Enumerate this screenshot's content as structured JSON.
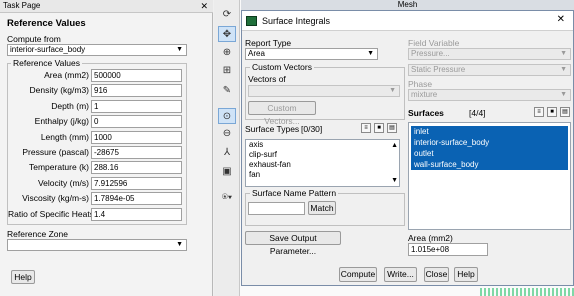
{
  "task_page": {
    "title": "Task Page",
    "close": "✕",
    "heading": "Reference Values",
    "compute_from_label": "Compute from",
    "compute_from_value": "interior-surface_body",
    "group_label": "Reference Values",
    "fields": [
      {
        "label": "Area (mm2)",
        "value": "500000"
      },
      {
        "label": "Density (kg/m3)",
        "value": "916"
      },
      {
        "label": "Depth (m)",
        "value": "1"
      },
      {
        "label": "Enthalpy (j/kg)",
        "value": "0"
      },
      {
        "label": "Length (mm)",
        "value": "1000"
      },
      {
        "label": "Pressure (pascal)",
        "value": "-28675"
      },
      {
        "label": "Temperature (k)",
        "value": "288.16"
      },
      {
        "label": "Velocity (m/s)",
        "value": "7.912596"
      },
      {
        "label": "Viscosity (kg/m-s)",
        "value": "1.7894e-05"
      },
      {
        "label": "Ratio of Specific Heats",
        "value": "1.4"
      }
    ],
    "reference_zone_label": "Reference Zone",
    "reference_zone_value": "",
    "help_label": "Help"
  },
  "toolbar": {
    "icons": [
      "rotate-icon",
      "pan-icon",
      "zoom-in-icon",
      "zoom-box-icon",
      "probe-icon",
      "zoom-fit-icon",
      "zoom-out-icon",
      "axes-icon",
      "camera-icon",
      "view-dropdown-icon"
    ]
  },
  "graphics": {
    "title": "Mesh"
  },
  "dialog": {
    "title": "Surface Integrals",
    "close": "✕",
    "report_type_label": "Report Type",
    "report_type_value": "Area",
    "custom_vectors_label": "Custom Vectors",
    "vectors_of_label": "Vectors of",
    "custom_vectors_button": "Custom Vectors...",
    "field_variable_label": "Field Variable",
    "field_variable_value": "Pressure...",
    "field_variable_sub": "Static Pressure",
    "phase_label": "Phase",
    "phase_value": "mixture",
    "surface_types_label": "Surface Types",
    "surface_types_count": "[0/30]",
    "surface_types": [
      "axis",
      "clip-surf",
      "exhaust-fan",
      "fan"
    ],
    "surfaces_label": "Surfaces",
    "surfaces_count": "[4/4]",
    "surfaces": [
      "inlet",
      "interior-surface_body",
      "outlet",
      "wall-surface_body"
    ],
    "surface_name_pattern_label": "Surface Name Pattern",
    "surface_name_pattern_value": "",
    "match_button": "Match",
    "save_output_button": "Save Output Parameter...",
    "result_label": "Area (mm2)",
    "result_value": "1.015e+08",
    "buttons": {
      "compute": "Compute",
      "write": "Write...",
      "close": "Close",
      "help": "Help"
    }
  }
}
